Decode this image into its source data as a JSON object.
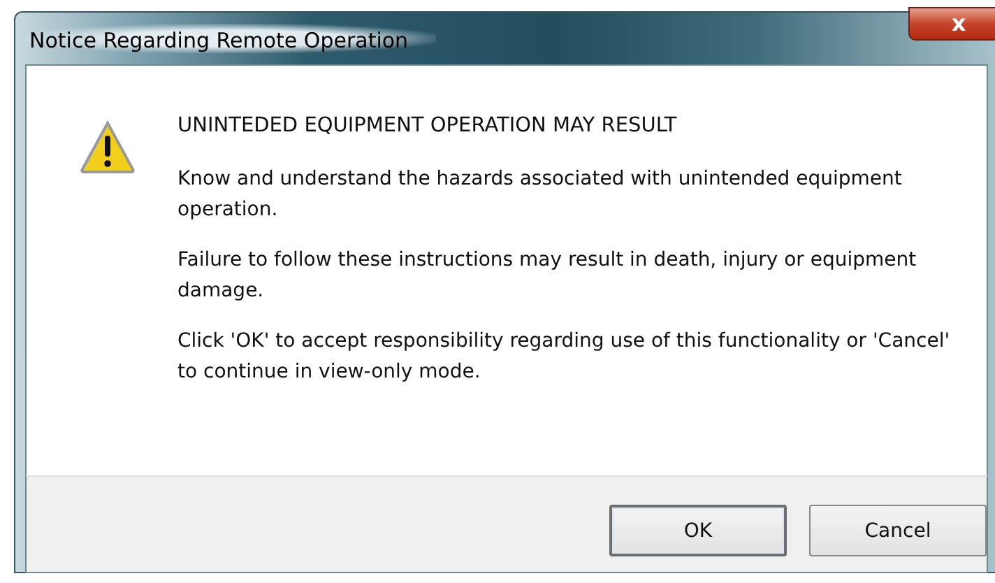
{
  "window": {
    "title": "Notice Regarding Remote Operation",
    "close": "x"
  },
  "message": {
    "heading": "UNINTEDED EQUIPMENT OPERATION MAY RESULT",
    "paragraphs": [
      "Know and understand the hazards associated with unintended equipment operation.",
      "Failure to follow these instructions may result in death, injury or equipment damage.",
      "Click 'OK' to accept responsibility regarding use of this functionality or 'Cancel' to continue in view-only mode."
    ]
  },
  "buttons": [
    {
      "label": "OK",
      "default": true
    },
    {
      "label": "Cancel",
      "default": false
    }
  ]
}
